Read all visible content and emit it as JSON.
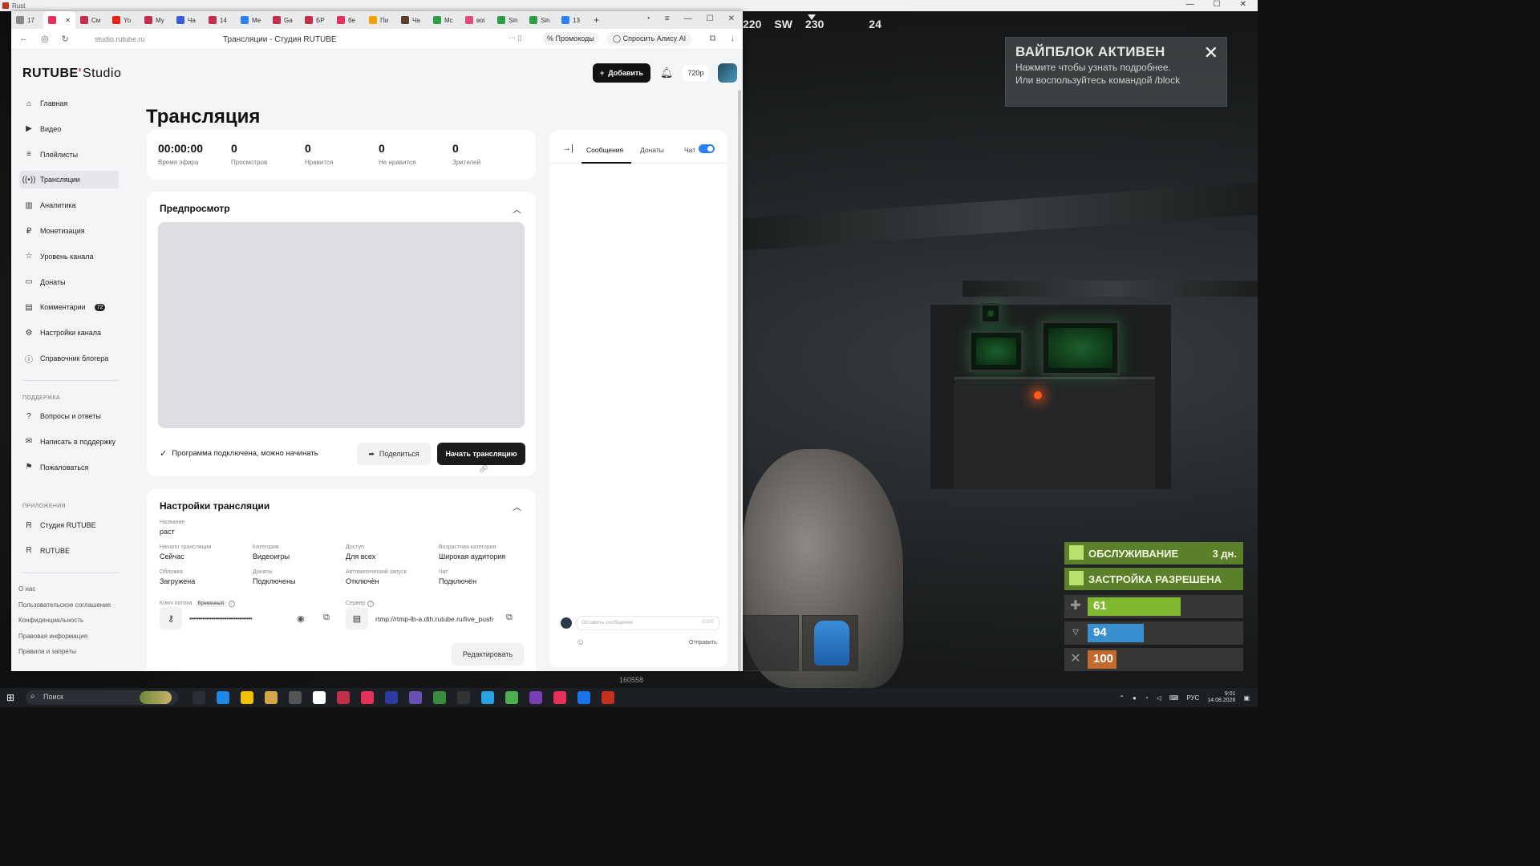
{
  "os": {
    "window_title": "Rust",
    "controls": [
      "—",
      "☐",
      "✕"
    ]
  },
  "game_hud": {
    "compass": [
      "220",
      "SW",
      "230",
      "24"
    ],
    "wipe_banner": {
      "title": "ВАЙПБЛОК АКТИВЕН",
      "line1": "Нажмите чтобы узнать подробнее.",
      "line2": "Или воспользуйтесь командой /block"
    },
    "maintenance": {
      "label": "ОБСЛУЖИВАНИЕ",
      "value": "3 дн."
    },
    "building": {
      "label": "ЗАСТРОЙКА РАЗРЕШЕНА"
    },
    "health": "61",
    "hydration": "94",
    "food": "100",
    "version": "160558"
  },
  "browser": {
    "tabs": [
      {
        "label": "17",
        "color": "#888888"
      },
      {
        "label": "",
        "color": "#e6325a",
        "active": true
      },
      {
        "label": "См",
        "color": "#c22f4a"
      },
      {
        "label": "Yo",
        "color": "#e62117"
      },
      {
        "label": "My",
        "color": "#c22f4a"
      },
      {
        "label": "Ча",
        "color": "#3b5bdb"
      },
      {
        "label": "14",
        "color": "#c22f4a"
      },
      {
        "label": "Me",
        "color": "#2d7ff9"
      },
      {
        "label": "Ga",
        "color": "#c22f4a"
      },
      {
        "label": "БР",
        "color": "#c22f4a"
      },
      {
        "label": "бе",
        "color": "#e6325a"
      },
      {
        "label": "Пи",
        "color": "#f59f00"
      },
      {
        "label": "Ча",
        "color": "#5c3d2e"
      },
      {
        "label": "Mc",
        "color": "#2f9e44"
      },
      {
        "label": "воі",
        "color": "#e64980"
      },
      {
        "label": "Sin",
        "color": "#2f9e44"
      },
      {
        "label": "Sin",
        "color": "#2f9e44"
      },
      {
        "label": "13",
        "color": "#2d7ff9"
      }
    ],
    "url": "studio.rutube.ru",
    "page_title": "Трансляции - Студия RUTUBE",
    "promo_label": "Промокоды",
    "alice_label": "Спросить Алису AI"
  },
  "studio": {
    "logo_main": "RUTUBE",
    "logo_studio": "Studio",
    "nav": [
      {
        "label": "Главная",
        "icon": "⌂"
      },
      {
        "label": "Видео",
        "icon": "▶"
      },
      {
        "label": "Плейлисты",
        "icon": "≡"
      },
      {
        "label": "Трансляции",
        "icon": "((•))",
        "active": true
      },
      {
        "label": "Аналитика",
        "icon": "▥"
      },
      {
        "label": "Монетизация",
        "icon": "₽"
      },
      {
        "label": "Уровень канала",
        "icon": "☆"
      },
      {
        "label": "Донаты",
        "icon": "▭"
      },
      {
        "label": "Комментарии",
        "icon": "▤",
        "badge": "72"
      },
      {
        "label": "Настройки канала",
        "icon": "⚙"
      },
      {
        "label": "Справочник блогера",
        "icon": "ⓘ"
      }
    ],
    "support_heading": "ПОДДЕРЖКА",
    "support_nav": [
      {
        "label": "Вопросы и ответы",
        "icon": "?"
      },
      {
        "label": "Написать в поддержку",
        "icon": "✉"
      },
      {
        "label": "Пожаловаться",
        "icon": "⚑"
      }
    ],
    "apps_heading": "ПРИЛОЖЕНИЯ",
    "apps_nav": [
      {
        "label": "Студия RUTUBE",
        "icon": "R"
      },
      {
        "label": "RUTUBE",
        "icon": "R"
      }
    ],
    "footer_links": [
      "О нас",
      "Пользовательское соглашение",
      "Конфиденциальность",
      "Правовая информация",
      "Правила и запреты"
    ],
    "topbar": {
      "add_label": "Добавить",
      "quality": "720p"
    },
    "page_title": "Трансляция",
    "stats": [
      {
        "value": "00:00:00",
        "label": "Время эфира"
      },
      {
        "value": "0",
        "label": "Просмотров"
      },
      {
        "value": "0",
        "label": "Нравится"
      },
      {
        "value": "0",
        "label": "Не нравится"
      },
      {
        "value": "0",
        "label": "Зрителей"
      }
    ],
    "preview": {
      "heading": "Предпросмотр",
      "status": "Программа подключена, можно начинать",
      "share_label": "Поделиться",
      "start_label": "Начать трансляцию"
    },
    "settings": {
      "heading": "Настройки трансляции",
      "name_label": "Название",
      "name_value": "раст",
      "fields_row1": [
        {
          "label": "Начало трансляции",
          "value": "Сейчас"
        },
        {
          "label": "Категория",
          "value": "Видеоигры"
        },
        {
          "label": "Доступ",
          "value": "Для всех"
        },
        {
          "label": "Возрастная категория",
          "value": "Широкая аудитория"
        }
      ],
      "fields_row2": [
        {
          "label": "Обложка",
          "value": "Загружена"
        },
        {
          "label": "Донаты",
          "value": "Подключены"
        },
        {
          "label": "Автоматический запуск",
          "value": "Отключён"
        },
        {
          "label": "Чат",
          "value": "Подключён"
        }
      ],
      "key_label": "Ключ потока",
      "key_badge": "Временный",
      "key_value": "••••••••••••••••••••••••••••••••••",
      "server_label": "Сервер",
      "server_value": "rtmp://rtmp-lb-a.dth.rutube.ru/live_push",
      "edit_label": "Редактировать"
    },
    "chat": {
      "tab_messages": "Сообщения",
      "tab_donations": "Донаты",
      "toggle_label": "Чат",
      "input_placeholder": "Оставить сообщение",
      "counter": "0/200",
      "send_label": "Отправить"
    }
  },
  "taskbar": {
    "search_placeholder": "Поиск",
    "lang": "РУС",
    "time": "9:01",
    "date": "14.08.2026"
  }
}
